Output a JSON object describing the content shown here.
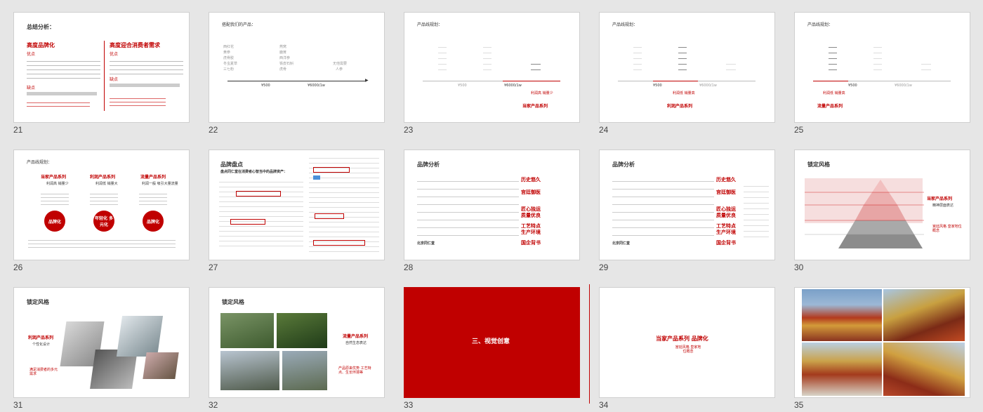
{
  "slides": [
    {
      "num": "21",
      "title": "总结分析：",
      "left_head": "高度品牌化",
      "left_pro": "优点",
      "left_con": "缺点",
      "left_note": "对品牌化都好的，品牌具有绝对优势，不够持续的独立",
      "right_head": "高度迎合消费者需求",
      "right_pro": "优点",
      "right_con": "缺点",
      "right_note": "迎合需求的，找到自身的优势"
    },
    {
      "num": "22",
      "title": "搭配我们的产品：",
      "col1": [
        "西红花",
        "黄参",
        "虎骨胶",
        "冬虫夏草",
        "三七粉"
      ],
      "col2": [
        "燕窝",
        "鹿茸",
        "西洋参",
        "铁皮石斛",
        "虎骨"
      ],
      "col3": [
        "无他需要",
        "人参"
      ],
      "tick1": "¥500",
      "tick2": "¥6000/1w"
    },
    {
      "num": "23",
      "title": "产品线规划：",
      "tick1": "¥500",
      "tick2": "¥6000/1w",
      "note": "利润高 销量少",
      "series": "当家产品系列"
    },
    {
      "num": "24",
      "title": "产品线规划：",
      "tick1": "¥500",
      "tick2": "¥6000/1w",
      "note": "利润低 销量高",
      "series": "利润产品系列"
    },
    {
      "num": "25",
      "title": "产品线规划：",
      "tick1": "¥500",
      "tick2": "¥6000/1w",
      "note": "利润低 销量高",
      "series": "流量产品系列"
    },
    {
      "num": "26",
      "title": "产品线规划：",
      "cols": [
        {
          "name": "当家产品系列",
          "sub": "利润高 销量少",
          "circle": "品牌化"
        },
        {
          "name": "利润产品系列",
          "sub": "利润低 销量大",
          "circle": "年轻化 多元化"
        },
        {
          "name": "流量产品系列",
          "sub": "利润一般 吸引大量流量",
          "circle": "品牌化"
        }
      ]
    },
    {
      "num": "27",
      "title": "品牌盘点",
      "subtitle": "盘点同仁堂在消费者心智当中的品牌资产："
    },
    {
      "num": "28",
      "title": "品牌分析",
      "tags": [
        "历史悠久",
        "宫廷御医",
        "匠心独运 质量优良",
        "工艺特点 生产环境",
        "国企背书"
      ],
      "footer": "北京同仁堂"
    },
    {
      "num": "29",
      "title": "品牌分析",
      "tags": [
        "历史悠久",
        "宫廷御医",
        "匠心独运 质量优良",
        "工艺特点 生产环境",
        "国企背书"
      ],
      "footer": "北京同仁堂"
    },
    {
      "num": "30",
      "title": "锁定风格",
      "series": "当家产品系列",
      "series_sub": "精神层面表达",
      "note": "宫廷风格 皇家地位概念"
    },
    {
      "num": "31",
      "title": "锁定风格",
      "series": "利润产品系列",
      "series_sub": "个性化设计",
      "note": "满足消费者的多元需求"
    },
    {
      "num": "32",
      "title": "锁定风格",
      "series": "流量产品系列",
      "series_sub": "自然生态表达",
      "note": "产品原来优势 工艺特点、生长环境等"
    },
    {
      "num": "33",
      "title": "三、视觉创意"
    },
    {
      "num": "34",
      "title": "当家产品系列 品牌化",
      "sub": "宫廷风格 皇家地位概念"
    },
    {
      "num": "35"
    }
  ],
  "colors": {
    "accent": "#c00000",
    "background": "#e6e6e6"
  }
}
